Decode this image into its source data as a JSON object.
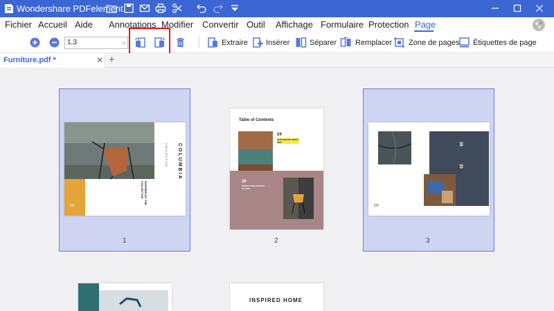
{
  "app": {
    "title": "Wondershare PDFelement"
  },
  "menu": {
    "items": [
      "Fichier",
      "Accueil",
      "Aide",
      "Annotations",
      "Modifier",
      "Convertir",
      "Outil",
      "Affichage",
      "Formulaire",
      "Protection",
      "Page"
    ],
    "active": "Page"
  },
  "toolbar": {
    "page_range_value": "1,3",
    "extract": "Extraire",
    "insert": "Insérer",
    "split": "Séparer",
    "replace": "Remplacer",
    "page_box": "Zone de pages",
    "labels": "Étiquettes de page"
  },
  "tab": {
    "name": "Furniture.pdf *"
  },
  "pages": {
    "p1": {
      "number": "1",
      "brand": "COLUMBIA",
      "brand_sub": "COLLECTIVE",
      "badge": "CF",
      "caption": "INSPIRED BY THE COLLECTIVE"
    },
    "p2": {
      "number": "2",
      "heading": "Table of Contents",
      "n24": "24",
      "n24_text": "OUR HISTORY SINCE 1982",
      "n26": "26",
      "n26_text": "SYNDICATING DESIGN VALUES"
    },
    "p3": {
      "number": "3",
      "n28": "28",
      "n30": "30",
      "badge": "CF"
    },
    "p5": {
      "heading": "INSPIRED HOME"
    }
  },
  "colors": {
    "accent": "#3b66d4",
    "highlight": "#e3151d",
    "selection": "#cfd4f2"
  }
}
